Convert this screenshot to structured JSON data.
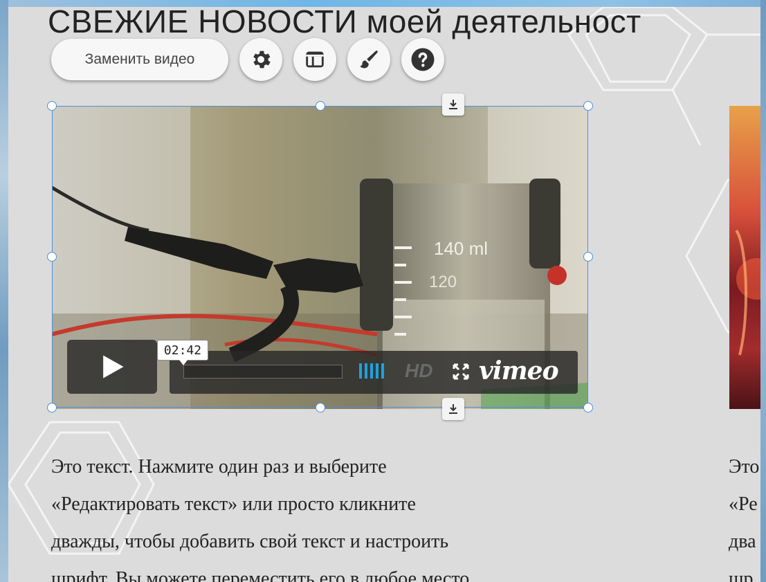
{
  "page": {
    "title": "СВЕЖИЕ НОВОСТИ моей деятельност"
  },
  "toolbar": {
    "replace_video_label": "Заменить видео",
    "buttons": [
      {
        "name": "settings",
        "icon": "gear-icon"
      },
      {
        "name": "layout",
        "icon": "layout-icon"
      },
      {
        "name": "design",
        "icon": "brush-icon"
      },
      {
        "name": "help",
        "icon": "help-icon"
      }
    ]
  },
  "video": {
    "time_tooltip": "02:42",
    "hd_label": "HD",
    "logo": "vimeo",
    "progress": 0,
    "accent_color": "#1ca2e0"
  },
  "text_block_1": {
    "lines": [
      "Это текст. Нажмите один раз и выберите",
      "«Редактировать текст» или просто кликните",
      "дважды, чтобы добавить свой текст и настроить",
      "шрифт. Вы можете переместить его в любое место"
    ]
  },
  "text_block_2": {
    "lines": [
      "Это",
      "«Ре",
      "два",
      "шр"
    ]
  }
}
